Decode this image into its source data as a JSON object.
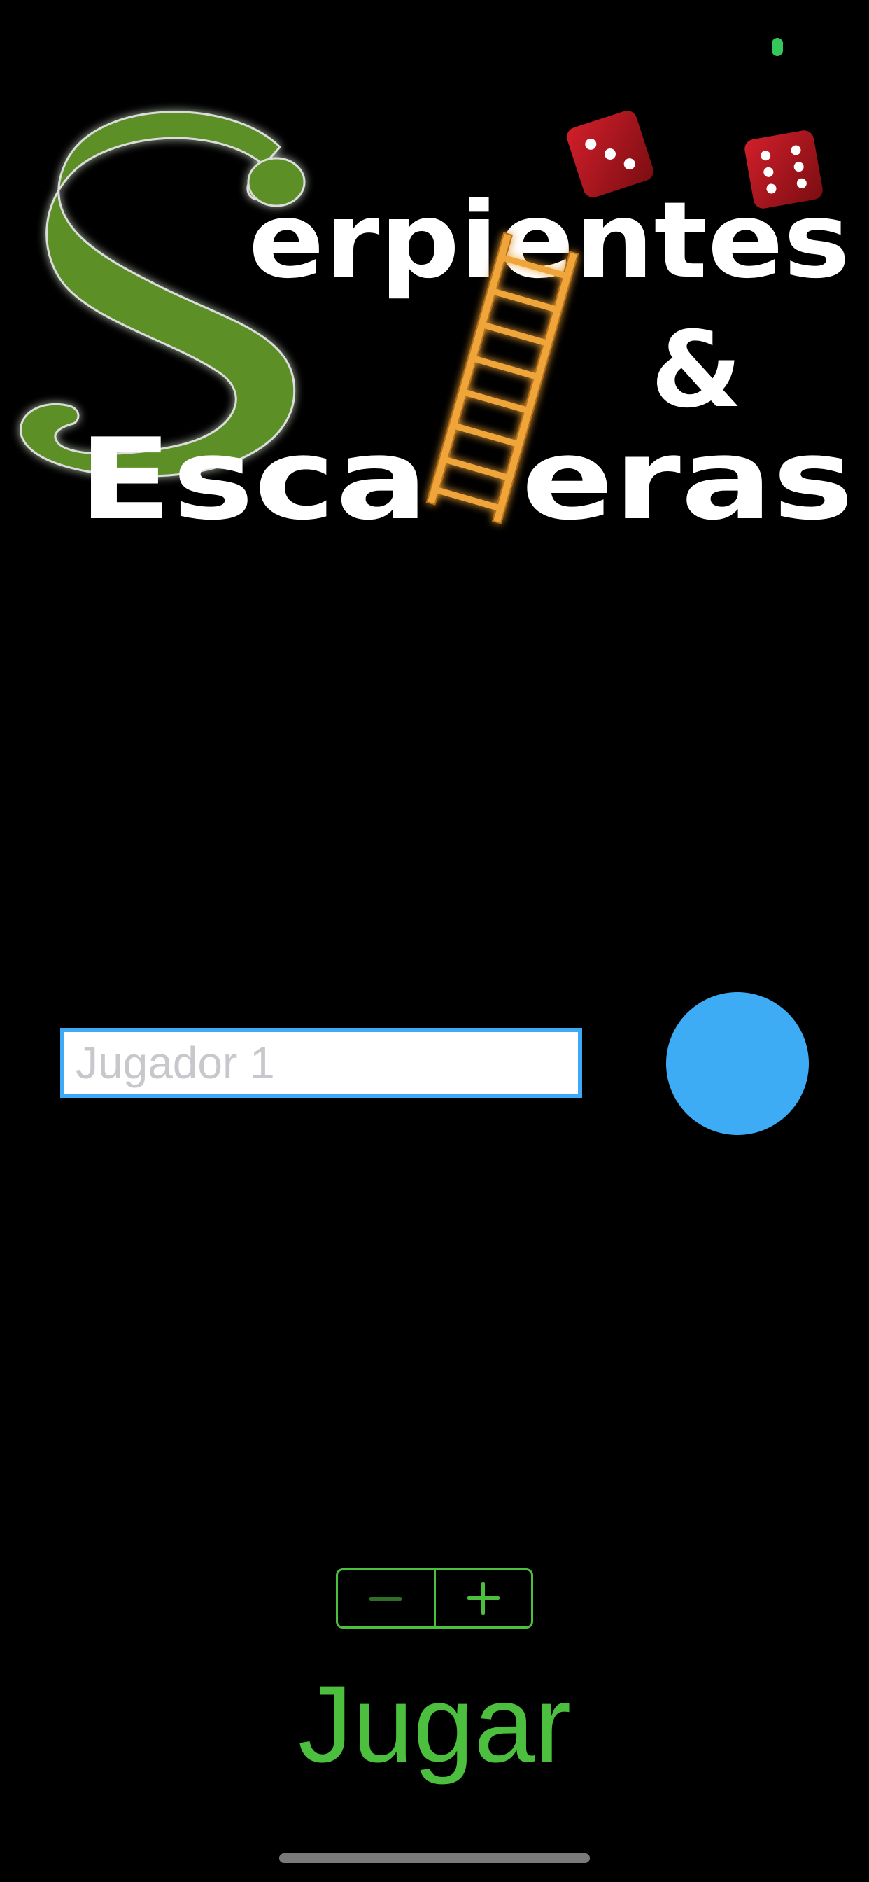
{
  "status_bar": {
    "indicator_color": "#34c759"
  },
  "logo": {
    "line1_rest": "erpientes",
    "big_letter": "S",
    "ampersand": "&",
    "line2_part1": "Esca",
    "line2_part2": "eras",
    "icons": [
      "snake-icon",
      "ladder-icon",
      "dice-icon"
    ]
  },
  "player": {
    "name_value": "",
    "name_placeholder": "Jugador 1",
    "color": "#3eacf4"
  },
  "stepper": {
    "minus_icon": "minus-icon",
    "plus_icon": "plus-icon"
  },
  "play_button": {
    "label": "Jugar",
    "color": "#4cbf3f"
  }
}
